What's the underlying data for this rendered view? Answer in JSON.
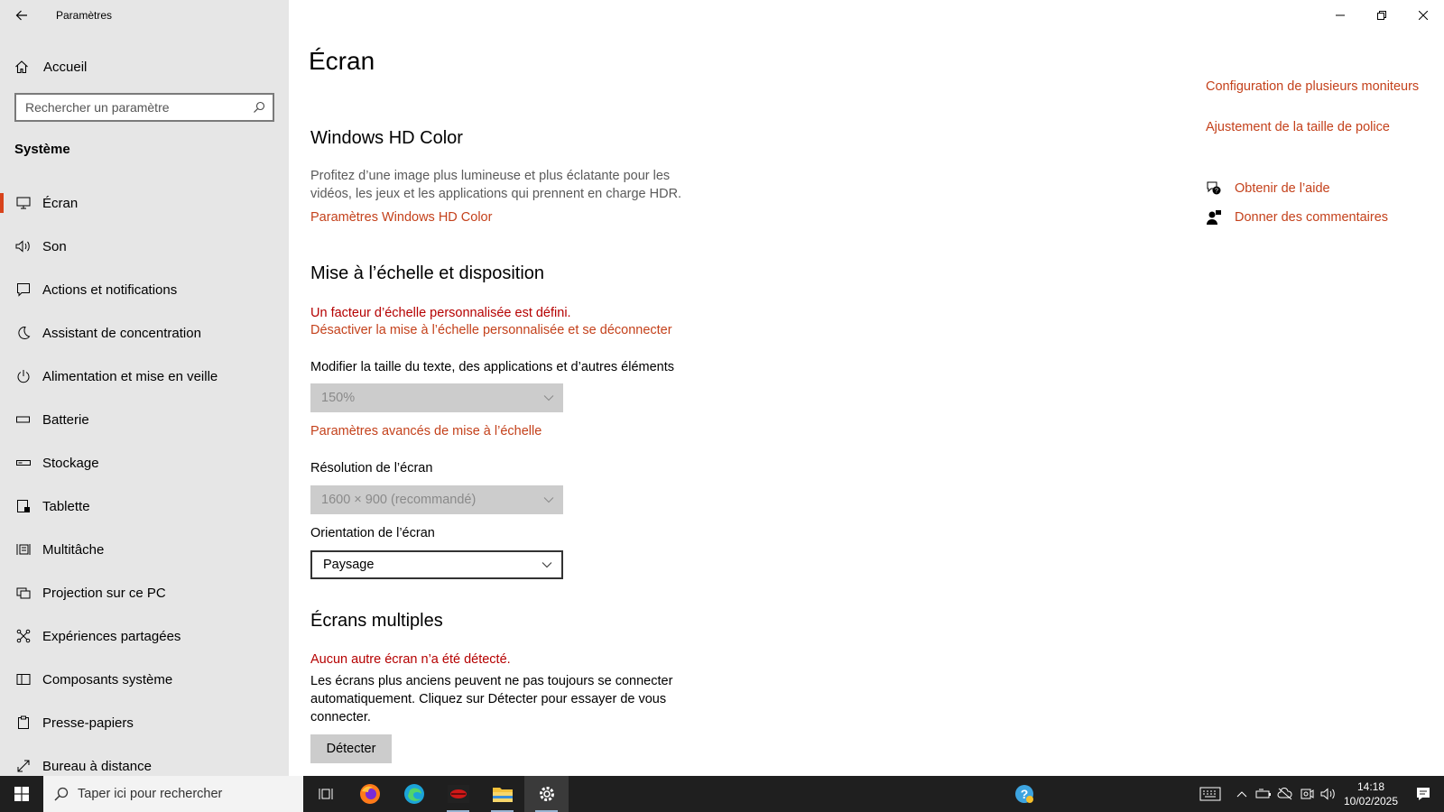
{
  "app": {
    "title": "Paramètres"
  },
  "sidebar": {
    "home_label": "Accueil",
    "search_placeholder": "Rechercher un paramètre",
    "section": "Système",
    "items": [
      {
        "label": "Écran",
        "icon": "monitor-icon"
      },
      {
        "label": "Son",
        "icon": "speaker-icon"
      },
      {
        "label": "Actions et notifications",
        "icon": "notification-icon"
      },
      {
        "label": "Assistant de concentration",
        "icon": "moon-icon"
      },
      {
        "label": "Alimentation et mise en veille",
        "icon": "power-icon"
      },
      {
        "label": "Batterie",
        "icon": "battery-icon"
      },
      {
        "label": "Stockage",
        "icon": "storage-icon"
      },
      {
        "label": "Tablette",
        "icon": "tablet-icon"
      },
      {
        "label": "Multitâche",
        "icon": "multitask-icon"
      },
      {
        "label": "Projection sur ce PC",
        "icon": "projection-icon"
      },
      {
        "label": "Expériences partagées",
        "icon": "shared-icon"
      },
      {
        "label": "Composants système",
        "icon": "components-icon"
      },
      {
        "label": "Presse-papiers",
        "icon": "clipboard-icon"
      },
      {
        "label": "Bureau à distance",
        "icon": "remote-desktop-icon"
      }
    ]
  },
  "main": {
    "title": "Écran",
    "hd_color": {
      "heading": "Windows HD Color",
      "description": "Profitez d’une image plus lumineuse et plus éclatante pour les vidéos, les jeux et les applications qui prennent en charge HDR.",
      "link": "Paramètres Windows HD Color"
    },
    "scale": {
      "heading": "Mise à l’échelle et disposition",
      "warning": "Un facteur d’échelle personnalisée est défini.",
      "disable_link": "Désactiver la mise à l’échelle personnalisée et se déconnecter",
      "size_label": "Modifier la taille du texte, des applications et d’autres éléments",
      "size_value": "150%",
      "advanced_link": "Paramètres avancés de mise à l’échelle",
      "resolution_label": "Résolution de l’écran",
      "resolution_value": "1600 × 900 (recommandé)",
      "orientation_label": "Orientation de l’écran",
      "orientation_value": "Paysage"
    },
    "multi": {
      "heading": "Écrans multiples",
      "warning": "Aucun autre écran n’a été détecté.",
      "description": "Les écrans plus anciens peuvent ne pas toujours se connecter automatiquement. Cliquez sur Détecter pour essayer de vous connecter.",
      "detect_button": "Détecter"
    }
  },
  "related": {
    "link1": "Configuration de plusieurs moniteurs",
    "link2": "Ajustement de la taille de police",
    "help": "Obtenir de l’aide",
    "feedback": "Donner des commentaires"
  },
  "taskbar": {
    "search_placeholder": "Taper ici pour rechercher",
    "time": "14:18",
    "date": "10/02/2025"
  },
  "colors": {
    "accent": "#c4411b",
    "warning": "#b50000",
    "sidebar_bg": "#e6e6e6",
    "taskbar_bg": "#1f1f1f"
  }
}
